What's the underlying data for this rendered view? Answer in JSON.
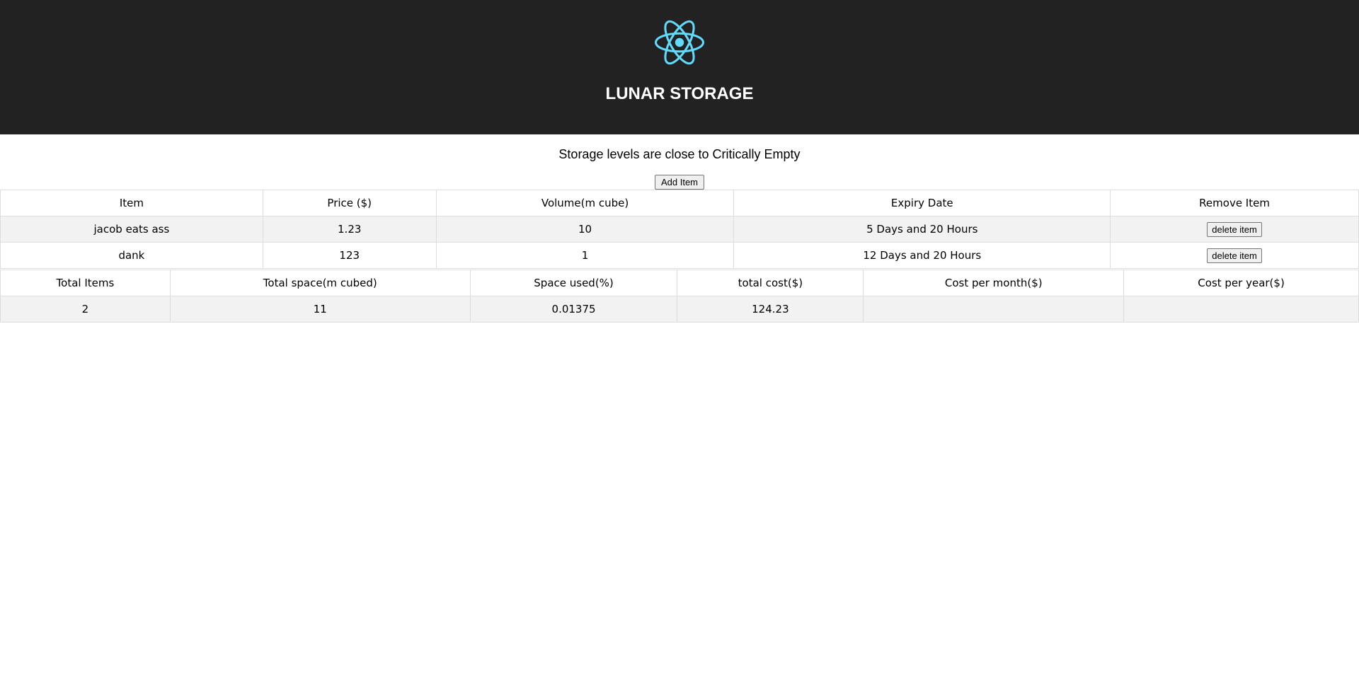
{
  "header": {
    "title": "LUNAR STORAGE",
    "logo_icon": "react-atom-icon",
    "background": "#222222",
    "logo_color": "#61dafb"
  },
  "status_message": "Storage levels are close to Critically Empty",
  "add_button_label": "Add Item",
  "items_table": {
    "headers": [
      "Item",
      "Price ($)",
      "Volume(m cube)",
      "Expiry Date",
      "Remove Item"
    ],
    "rows": [
      {
        "item": "jacob eats ass",
        "price": "1.23",
        "volume": "10",
        "expiry": "5 Days and 20 Hours",
        "action": "delete item"
      },
      {
        "item": "dank",
        "price": "123",
        "volume": "1",
        "expiry": "12 Days and 20 Hours",
        "action": "delete item"
      }
    ]
  },
  "summary_table": {
    "headers": [
      "Total Items",
      "Total space(m cubed)",
      "Space used(%)",
      "total cost($)",
      "Cost per month($)",
      "Cost per year($)"
    ],
    "row": {
      "total_items": "2",
      "total_space": "11",
      "space_used": "0.01375",
      "total_cost": "124.23",
      "cost_per_month": "",
      "cost_per_year": ""
    }
  }
}
